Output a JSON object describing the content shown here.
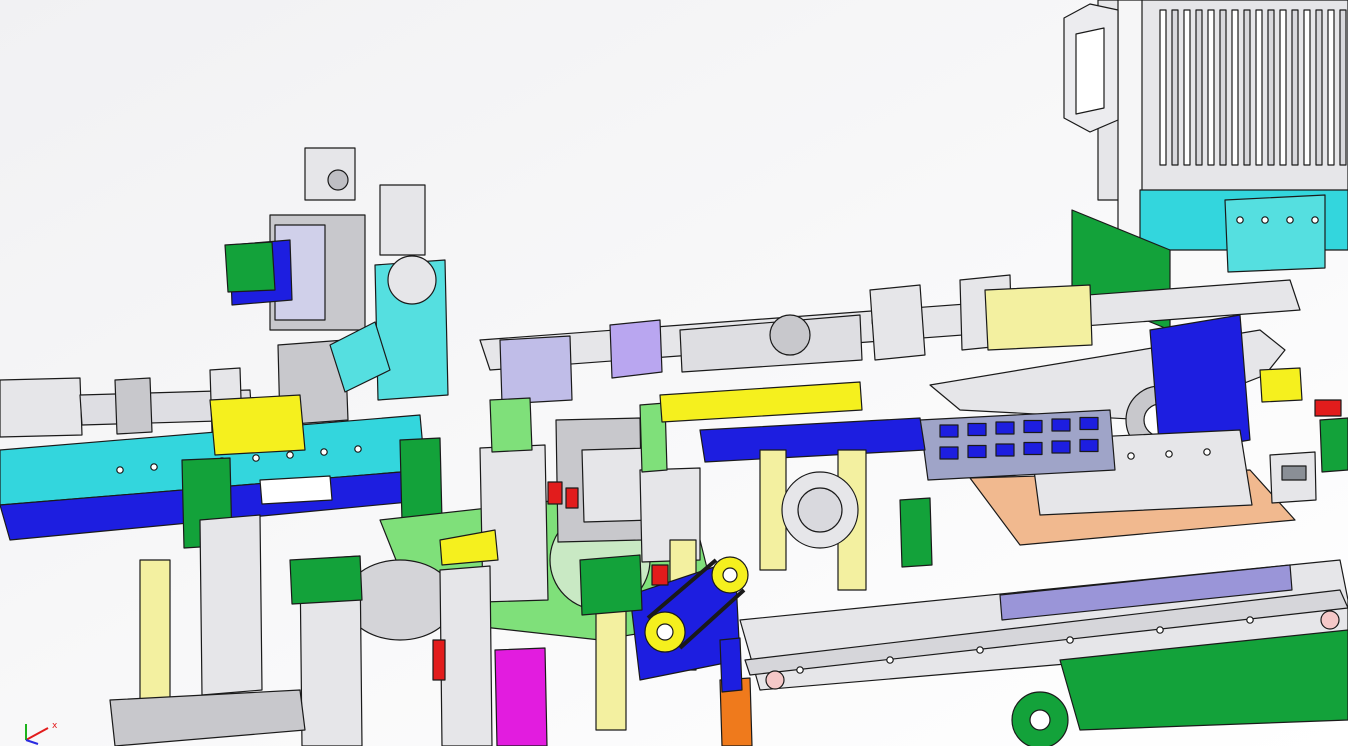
{
  "viewport": {
    "background_top": "#f3f3f4",
    "background_bottom": "#ffffff",
    "outline_color": "#1a1a1a"
  },
  "palette": {
    "steel": "#e6e6e9",
    "steel_dark": "#c8c8cc",
    "lavender": "#c0bde8",
    "violet": "#b9a6f0",
    "navy": "#1d1ee0",
    "cyan": "#33d6dd",
    "teal": "#55dfe0",
    "yellow": "#f5f01e",
    "pale_yellow": "#f3f0a0",
    "green": "#13a23a",
    "lime": "#7fe07a",
    "olive": "#5fa84a",
    "red": "#e21c1c",
    "magenta": "#e21cdf",
    "orange": "#ef7a1c",
    "peach": "#f1b98f",
    "gray_blue": "#9fa4c8"
  },
  "triad": {
    "x_label": "x",
    "x_color": "#e21c1c",
    "y_color": "#1db31d",
    "z_color": "#2a2ae0"
  }
}
